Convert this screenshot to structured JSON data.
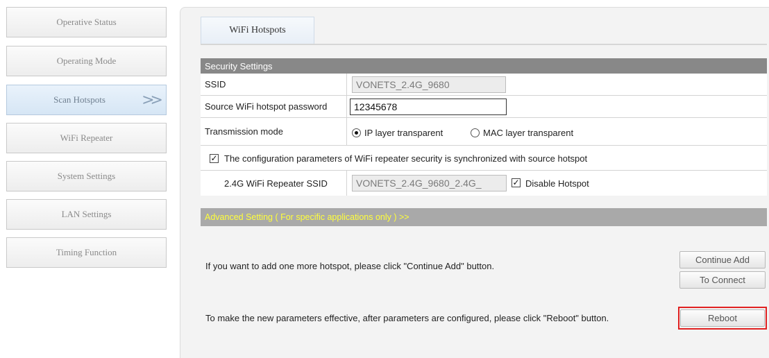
{
  "sidebar": {
    "items": [
      {
        "label": "Operative Status",
        "active": false
      },
      {
        "label": "Operating Mode",
        "active": false
      },
      {
        "label": "Scan Hotspots",
        "active": true
      },
      {
        "label": "WiFi Repeater",
        "active": false
      },
      {
        "label": "System Settings",
        "active": false
      },
      {
        "label": "LAN Settings",
        "active": false
      },
      {
        "label": "Timing Function",
        "active": false
      }
    ],
    "active_arrow": ">>"
  },
  "main": {
    "tab_label": "WiFi Hotspots",
    "security_header": "Security Settings",
    "ssid": {
      "label": "SSID",
      "value": "VONETS_2.4G_9680"
    },
    "password": {
      "label": "Source WiFi hotspot password",
      "value": "12345678"
    },
    "transmission": {
      "label": "Transmission mode",
      "options": [
        "IP layer transparent",
        "MAC layer transparent"
      ],
      "selected": "IP layer transparent"
    },
    "sync": {
      "label": "The configuration parameters of WiFi repeater security is synchronized with source hotspot",
      "checked": true
    },
    "repeater_ssid": {
      "label": "2.4G WiFi Repeater SSID",
      "value": "VONETS_2.4G_9680_2.4G_",
      "disable_label": "Disable Hotspot",
      "disable_checked": true
    },
    "advanced_label": "Advanced Setting ( For specific applications only ) >>",
    "continue_text": "If you want to add one more hotspot, please click \"Continue Add\" button.",
    "continue_btn": "Continue Add",
    "connect_btn": "To Connect",
    "reboot_text": "To make the new parameters effective, after parameters are configured, please click \"Reboot\" button.",
    "reboot_btn": "Reboot"
  },
  "colors": {
    "header_bg": "#888888",
    "advanced_bg": "#a9a9a9",
    "advanced_text": "#ffff3a",
    "highlight": "#e02020"
  }
}
